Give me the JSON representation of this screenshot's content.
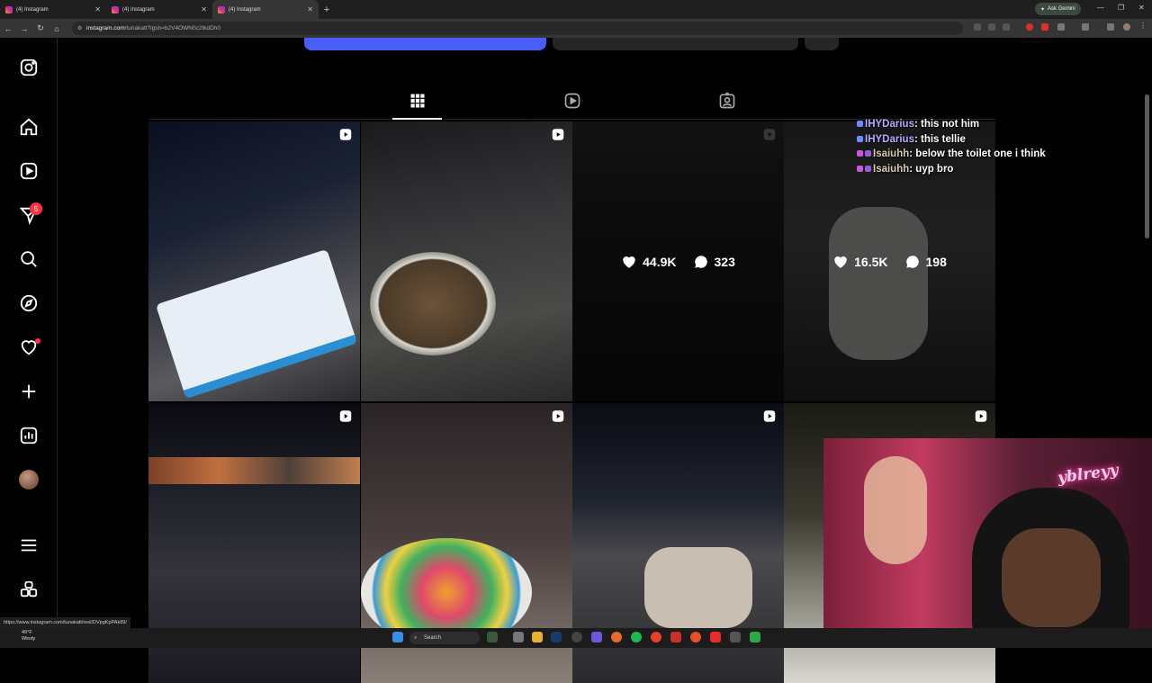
{
  "browser": {
    "tabs": [
      {
        "label": "(4) Instagram",
        "active": false
      },
      {
        "label": "(4) Instagram",
        "active": false
      },
      {
        "label": "(4) Instagram",
        "active": true
      }
    ],
    "ask_gemini": "Ask Gemini",
    "url_host": "instagram.com",
    "url_path": "/tunakatt?igsh=b2V4OWN0c2tkdDh0"
  },
  "sidebar": {
    "items": [
      "instagram-logo",
      "home",
      "reels",
      "messages",
      "search",
      "explore",
      "notifications",
      "create",
      "dashboard",
      "profile",
      "more",
      "also-from-meta"
    ],
    "messages_badge": "5"
  },
  "profile_tabs": [
    "posts",
    "reels",
    "tagged"
  ],
  "posts": [
    {
      "type": "reel",
      "likes": "",
      "comments": "",
      "hover": false,
      "desc": "cake night street"
    },
    {
      "type": "reel",
      "likes": "",
      "comments": "",
      "hover": false,
      "desc": "cereal bowl road"
    },
    {
      "type": "reel",
      "likes": "44.9K",
      "comments": "323",
      "hover": true,
      "desc": "dark car"
    },
    {
      "type": "reel",
      "likes": "16.5K",
      "comments": "198",
      "hover": true,
      "desc": "toilet"
    },
    {
      "type": "reel",
      "likes": "",
      "comments": "",
      "hover": false,
      "desc": "night street crowd"
    },
    {
      "type": "reel",
      "likes": "",
      "comments": "",
      "hover": false,
      "desc": "fruit loops party"
    },
    {
      "type": "reel",
      "likes": "",
      "comments": "",
      "hover": false,
      "desc": "overpass hands"
    },
    {
      "type": "reel",
      "likes": "",
      "comments": "",
      "hover": false,
      "desc": "light"
    }
  ],
  "chat": [
    {
      "user": "IHYDarius",
      "text": ": this not him",
      "style": "u1"
    },
    {
      "user": "IHYDarius",
      "text": ": this tellie",
      "style": "u1"
    },
    {
      "user": "Isaiuhh",
      "text": ": below the toilet one i think",
      "style": "u2"
    },
    {
      "user": "Isaiuhh",
      "text": ": uyp bro",
      "style": "u2"
    }
  ],
  "webcam": {
    "neon_sign": "yblreyy"
  },
  "status_url": "https://www.instagram.com/tunakatt/reel/DVpgKpPAk89/",
  "taskbar": {
    "temp": "49°F",
    "condition": "Windy",
    "search": "Search"
  },
  "colors": {
    "accent": "#4a5df9",
    "badge": "#ff3040"
  }
}
